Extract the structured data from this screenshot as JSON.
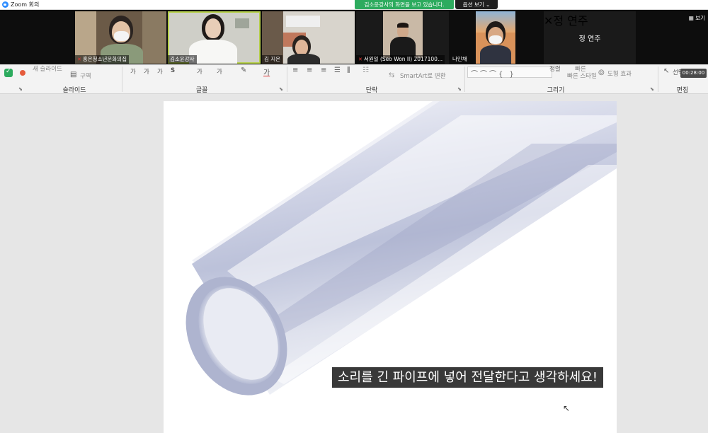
{
  "window": {
    "title": "Zoom 회의",
    "share_banner": "김소윤강사의 화면을 보고 있습니다.",
    "view_options": "옵션 보기 ⌄",
    "view_button": "▦ 보기"
  },
  "participants": [
    {
      "name": "홍은청소년문화의집",
      "muted": true
    },
    {
      "name": "김소윤강사",
      "muted": false
    },
    {
      "name": "김 지은",
      "muted": false
    },
    {
      "name": "서원일 (Seo Won Il) 2017100...",
      "muted": true
    },
    {
      "name": "나인채",
      "muted": false
    },
    {
      "name": "",
      "muted": false
    },
    {
      "name": "정 연주",
      "muted": true
    }
  ],
  "big_tile_name": "정 연주",
  "ribbon": {
    "groups": {
      "slide": "슬라이드",
      "font": "글꼴",
      "paragraph": "단락",
      "drawing": "그리기",
      "editing": "편집"
    },
    "new_slide": "새 슬라이드",
    "section": "구역",
    "smartart": "SmartArt로 변환",
    "arrange": "정렬",
    "quick_styles": "빠른 스타일",
    "shape_effects": "도형 효과",
    "select": "선택",
    "timer": "00:28:00",
    "font_buttons": [
      "가",
      "가",
      "가",
      "S",
      "가",
      "가"
    ]
  },
  "slide": {
    "caption": "소리를 긴 파이프에 넣어 전달한다고 생각하세요!"
  },
  "colors": {
    "zoom_blue": "#2d8cff",
    "share_green": "#2dab5e",
    "active_speaker": "#b6d04a",
    "tube_tint": "#b9bfd8"
  }
}
